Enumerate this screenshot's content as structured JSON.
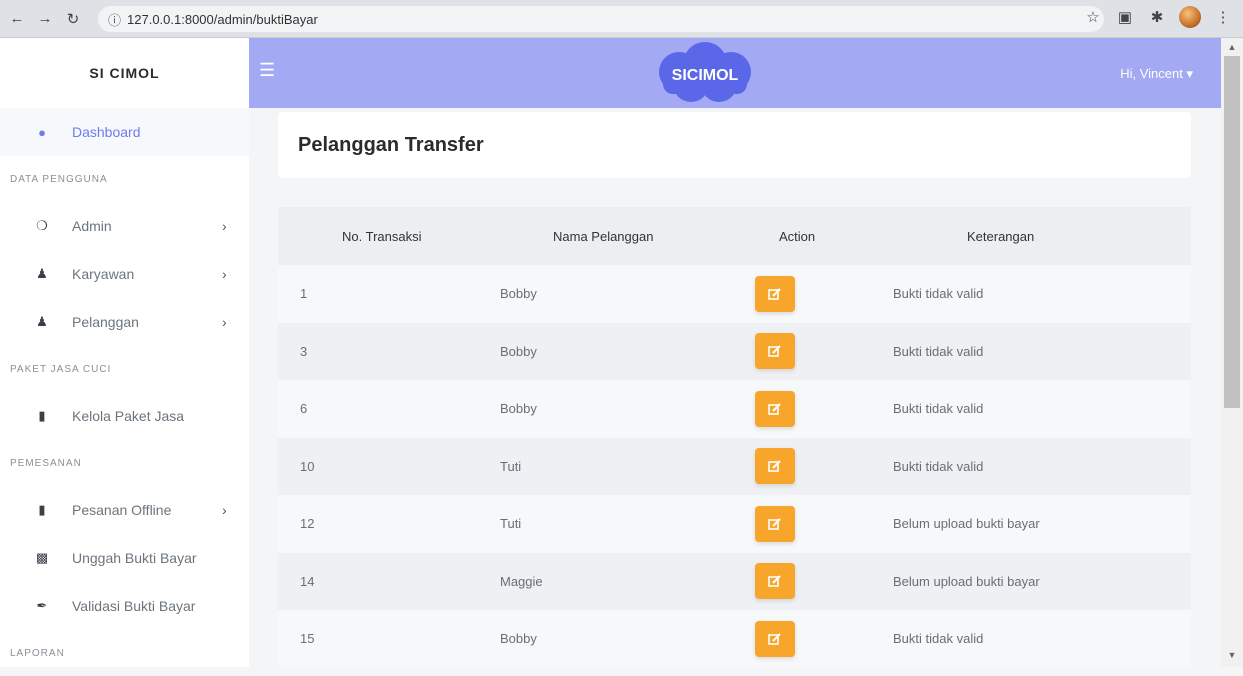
{
  "browser": {
    "url": "127.0.0.1:8000/admin/buktiBayar"
  },
  "sidebar": {
    "brand": "SI CIMOL",
    "dashboard": "Dashboard",
    "sections": [
      {
        "title": "DATA PENGGUNA",
        "items": [
          {
            "label": "Admin",
            "icon": "user-circle-icon"
          },
          {
            "label": "Karyawan",
            "icon": "user-icon"
          },
          {
            "label": "Pelanggan",
            "icon": "users-icon"
          }
        ]
      },
      {
        "title": "PAKET JASA CUCI",
        "items": [
          {
            "label": "Kelola Paket Jasa",
            "icon": "book-icon"
          }
        ]
      },
      {
        "title": "PEMESANAN",
        "items": [
          {
            "label": "Pesanan Offline",
            "icon": "file-icon"
          },
          {
            "label": "Unggah Bukti Bayar",
            "icon": "money-bill-icon"
          },
          {
            "label": "Validasi Bukti Bayar",
            "icon": "pen-icon"
          }
        ]
      },
      {
        "title": "LAPORAN",
        "items": []
      }
    ]
  },
  "topbar": {
    "logo": "SICIMOL",
    "greeting": "Hi, Vincent"
  },
  "page": {
    "title": "Pelanggan Transfer"
  },
  "table": {
    "headers": [
      "No. Transaksi",
      "Nama Pelanggan",
      "Action",
      "Keterangan"
    ],
    "rows": [
      {
        "no": "1",
        "nama": "Bobby",
        "keterangan": "Bukti tidak valid"
      },
      {
        "no": "3",
        "nama": "Bobby",
        "keterangan": "Bukti tidak valid"
      },
      {
        "no": "6",
        "nama": "Bobby",
        "keterangan": "Bukti tidak valid"
      },
      {
        "no": "10",
        "nama": "Tuti",
        "keterangan": "Bukti tidak valid"
      },
      {
        "no": "12",
        "nama": "Tuti",
        "keterangan": "Belum upload bukti bayar"
      },
      {
        "no": "14",
        "nama": "Maggie",
        "keterangan": "Belum upload bukti bayar"
      },
      {
        "no": "15",
        "nama": "Bobby",
        "keterangan": "Bukti tidak valid"
      }
    ]
  },
  "colors": {
    "topbar": "#a4a9f3",
    "accent": "#6f7bf0",
    "action_button": "#f7a52b"
  }
}
